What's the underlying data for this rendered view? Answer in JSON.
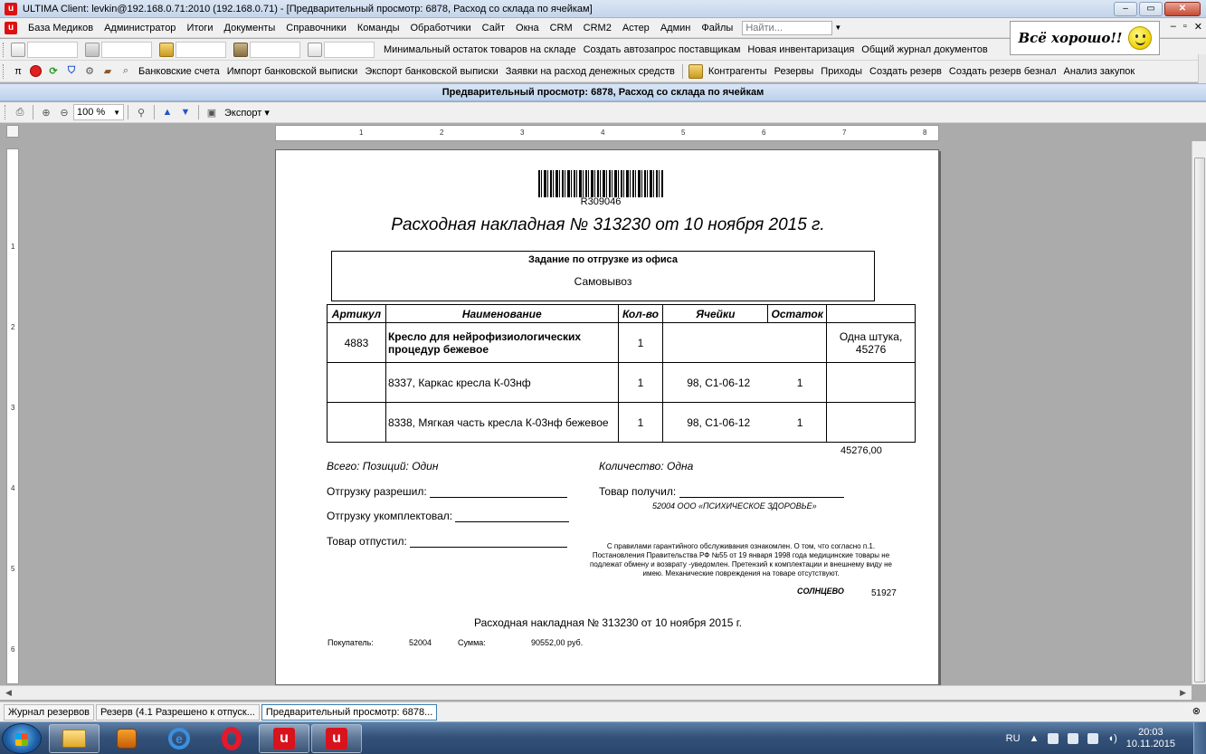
{
  "window": {
    "title": "ULTIMA Client: levkin@192.168.0.71:2010 (192.168.0.71) - [Предварительный просмотр: 6878, Расход со склада по ячейкам]",
    "minimize": "‒",
    "maximize": "▭",
    "close": "✕"
  },
  "menu": {
    "items": [
      "База Медиков",
      "Администратор",
      "Итоги",
      "Документы",
      "Справочники",
      "Команды",
      "Обработчики",
      "Сайт",
      "Окна",
      "CRM",
      "CRM2",
      "Астер",
      "Админ",
      "Файлы"
    ],
    "search_placeholder": "Найти..."
  },
  "banner": {
    "text": "Всё хорошо!!"
  },
  "toolbar1": {
    "links": [
      "Минимальный остаток товаров на складе",
      "Создать автозапрос поставщикам",
      "Новая инвентаризация",
      "Общий журнал документов"
    ]
  },
  "toolbar2": {
    "pi": "π",
    "links_a": [
      "Банковские счета",
      "Импорт банковской выписки",
      "Экспорт банковской выписки",
      "Заявки на расход денежных средств"
    ],
    "links_b": [
      "Контрагенты",
      "Резервы",
      "Приходы",
      "Создать резерв",
      "Создать резерв безнал",
      "Анализ закупок"
    ]
  },
  "preview": {
    "header": "Предварительный просмотр: 6878, Расход со склада по ячейкам",
    "zoom": "100 %",
    "export_label": "Экспорт"
  },
  "ruler": {
    "h_marks": [
      "1",
      "2",
      "3",
      "4",
      "5",
      "6",
      "7",
      "8"
    ],
    "v_marks": [
      "1",
      "2",
      "3",
      "4",
      "5",
      "6"
    ]
  },
  "document": {
    "barcode_number": "R309046",
    "title": "Расходная накладная № 313230 от 10 ноября 2015 г.",
    "task_title": "Задание по отгрузке из офиса",
    "delivery": "Самовывоз",
    "columns": [
      "Артикул",
      "Наименование",
      "Кол-во",
      "Ячейки",
      "Остаток",
      ""
    ],
    "rows": [
      {
        "article": "4883",
        "name": "Кресло для нейрофизиологических процедур бежевое",
        "qty": "1",
        "cells": "",
        "rest": "",
        "price": "Одна  штука, 45276"
      },
      {
        "article": "",
        "name": "8337, Каркас кресла К-03нф",
        "qty": "1",
        "cells": "98,  С1-06-12",
        "rest": "1",
        "price": ""
      },
      {
        "article": "",
        "name": "8338, Мягкая часть  кресла К-03нф бежевое",
        "qty": "1",
        "cells": "98,  С1-06-12",
        "rest": "1",
        "price": ""
      }
    ],
    "total": "45276,00",
    "positions_label": "Всего: Позиций:",
    "positions_value": "Один",
    "quantity_label": "Количество:",
    "quantity_value": "Одна",
    "allowed_label": "Отгрузку разрешил:",
    "assembled_label": "Отгрузку укомплектовал:",
    "released_label": "Товар отпустил:",
    "received_label": "Товар получил:",
    "buyer": "52004 ООО «ПСИХИЧЕСКОЕ ЗДОРОВЬЕ»",
    "fineprint": "С правилами гарантийного обслуживания ознакомлен. О том, что согласно п.1. Постановления  Правительства РФ №55 от 19 января 1998 года медицинские товары не подлежат обмену и возврату -уведомлен. Претензий к комплектации и внешнему виду не имею. Механические повреждения на товаре отсутствуют.",
    "place": "СОЛНЦЕВО",
    "code2": "51927",
    "footer_title": "Расходная накладная № 313230 от 10 ноября 2015 г.",
    "footer_buyer_label": "Покупатель:",
    "footer_buyer_value": "52004",
    "footer_sum_label": "Сумма:",
    "footer_sum_value": "90552,00  руб."
  },
  "mdi_tabs": [
    {
      "label": "Журнал резервов",
      "active": false
    },
    {
      "label": "Резерв (4.1 Разрешено к отпуск...",
      "active": false
    },
    {
      "label": "Предварительный просмотр: 6878...",
      "active": true
    }
  ],
  "taskbar": {
    "lang": "RU",
    "time": "20:03",
    "date": "10.11.2015"
  }
}
